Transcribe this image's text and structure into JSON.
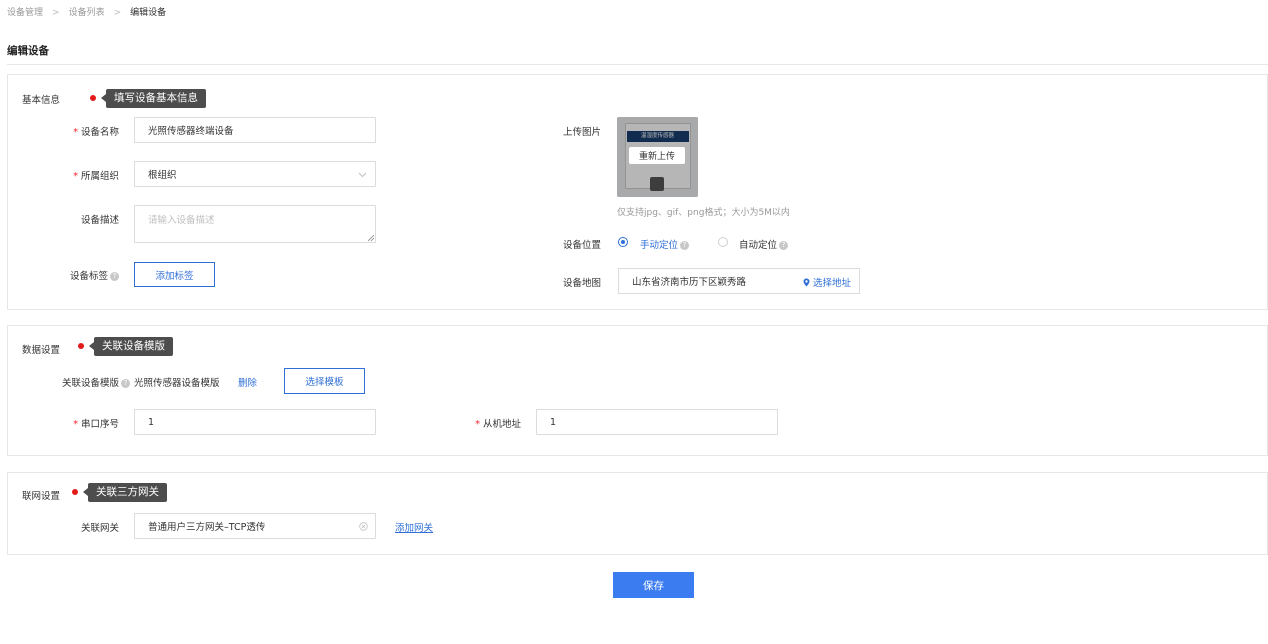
{
  "breadcrumb": [
    "设备管理",
    "设备列表",
    "编辑设备"
  ],
  "page_title": "编辑设备",
  "basic": {
    "section_label": "基本信息",
    "tip": "填写设备基本信息",
    "name_label": "设备名称",
    "name_value": "光照传感器终端设备",
    "org_label": "所属组织",
    "org_value": "根组织",
    "desc_label": "设备描述",
    "desc_placeholder": "请输入设备描述",
    "tag_label": "设备标签",
    "add_tag": "添加标签",
    "upload_label": "上传图片",
    "reupload": "重新上传",
    "upload_hint": "仅支持jpg、gif、png格式；大小为5M以内",
    "thumb_title": "温湿度传感器",
    "location_label": "设备位置",
    "manual": "手动定位",
    "auto": "自动定位",
    "map_label": "设备地图",
    "map_value": "山东省济南市历下区颖秀路",
    "select_address": "选择地址"
  },
  "data_settings": {
    "section_label": "数据设置",
    "tip": "关联设备模版",
    "template_label": "关联设备模版",
    "template_value": "光照传感器设备模版",
    "delete": "删除",
    "select_template": "选择模板",
    "serial_label": "串口序号",
    "serial_value": "1",
    "slave_label": "从机地址",
    "slave_value": "1"
  },
  "network": {
    "section_label": "联网设置",
    "tip": "关联三方网关",
    "gateway_label": "关联网关",
    "gateway_value": "普通用户三方网关–TCP透传",
    "add_gateway": "添加网关"
  },
  "save": "保存",
  "colors": {
    "primary": "#2f6fd6",
    "save_button": "#3b7cf0",
    "required": "#f5222d",
    "tip_bg": "#4d4d4d"
  },
  "icons": {
    "question": "question-circle-icon",
    "clear": "close-circle-icon",
    "location": "location-pin-icon",
    "dropdown": "chevron-down-icon",
    "resize": "resize-handle-icon"
  }
}
